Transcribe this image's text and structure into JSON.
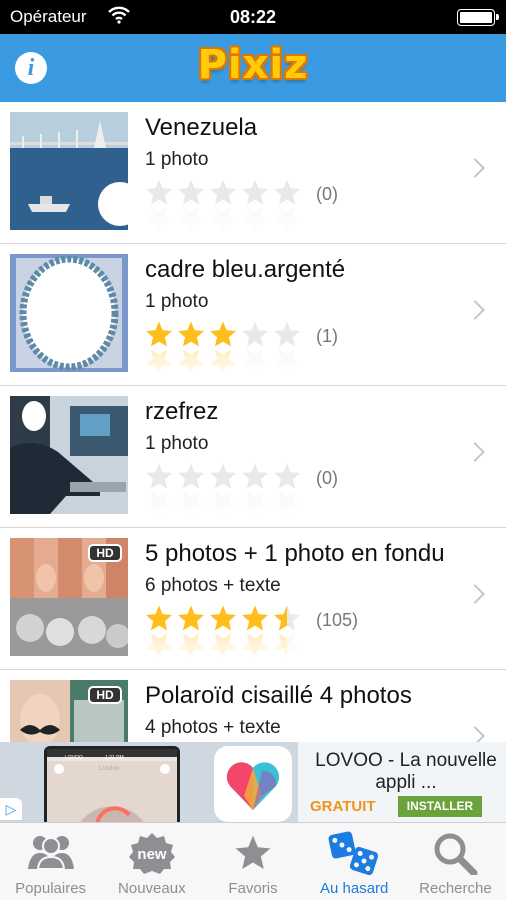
{
  "status_bar": {
    "carrier": "Opérateur",
    "time": "08:22"
  },
  "nav": {
    "logo": "Pixiz",
    "info_icon": "info-icon",
    "info_label": "i"
  },
  "list": {
    "items": [
      {
        "title": "Venezuela",
        "subtitle": "1 photo",
        "rating": 0,
        "count": "(0)",
        "hd": false
      },
      {
        "title": "cadre bleu.argenté",
        "subtitle": "1 photo",
        "rating": 3,
        "count": "(1)",
        "hd": false
      },
      {
        "title": "rzefrez",
        "subtitle": "1 photo",
        "rating": 0,
        "count": "(0)",
        "hd": false
      },
      {
        "title": "5 photos + 1 photo en fondu",
        "subtitle": "6 photos + texte",
        "rating": 4.5,
        "count": "(105)",
        "hd": true
      },
      {
        "title": "Polaroïd cisaillé 4 photos",
        "subtitle": "4 photos + texte",
        "rating": 0,
        "count": "",
        "hd": true
      }
    ],
    "hd_label": "HD",
    "max_stars": 5
  },
  "ad": {
    "title": "LOVOO - La nouvelle appli ...",
    "price": "GRATUIT",
    "install_label": "INSTALLER",
    "phone_brand": "LOVOO",
    "phone_time": "1:21 PM",
    "phone_city": "London",
    "adchoice_icon": "adchoices-icon",
    "colors": {
      "install": "#6aa33a",
      "price": "#f0931a"
    }
  },
  "tabs": [
    {
      "label": "Populaires",
      "icon": "people-icon",
      "active": false
    },
    {
      "label": "Nouveaux",
      "icon": "new-badge-icon",
      "active": false
    },
    {
      "label": "Favoris",
      "icon": "star-icon",
      "active": false
    },
    {
      "label": "Au hasard",
      "icon": "dice-icon",
      "active": true
    },
    {
      "label": "Recherche",
      "icon": "magnifier-icon",
      "active": false
    }
  ],
  "colors": {
    "nav_bg": "#3a9be2",
    "star_filled": "#ffbe1a",
    "star_empty": "#e9e9e9",
    "tab_active": "#1d7ce0",
    "tab_inactive": "#8e8e93"
  }
}
